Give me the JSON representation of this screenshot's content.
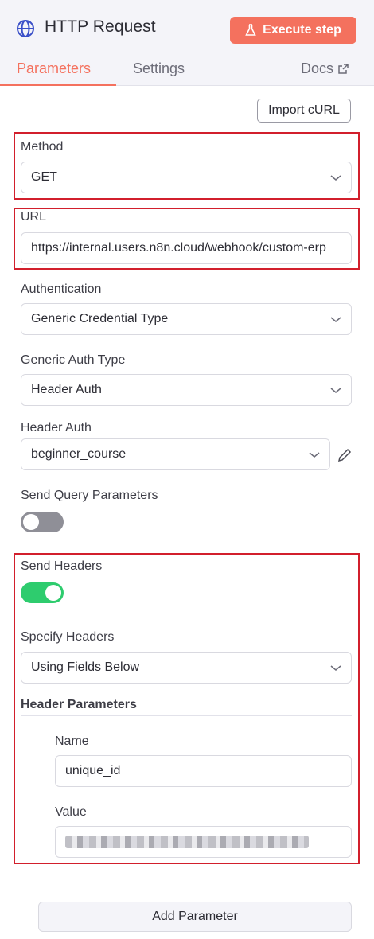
{
  "header": {
    "title": "HTTP Request",
    "execute_label": "Execute step",
    "icon": "globe-icon",
    "accent_color": "#f4715e"
  },
  "tabs": {
    "parameters": "Parameters",
    "settings": "Settings",
    "docs": "Docs",
    "active": "Parameters"
  },
  "import_curl_label": "Import cURL",
  "method": {
    "label": "Method",
    "value": "GET"
  },
  "url": {
    "label": "URL",
    "value": "https://internal.users.n8n.cloud/webhook/custom-erp"
  },
  "authentication": {
    "label": "Authentication",
    "value": "Generic Credential Type"
  },
  "generic_auth_type": {
    "label": "Generic Auth Type",
    "value": "Header Auth"
  },
  "header_auth": {
    "label": "Header Auth",
    "value": "beginner_course",
    "edit_icon": "pencil-icon"
  },
  "send_query": {
    "label": "Send Query Parameters",
    "enabled": false
  },
  "send_headers": {
    "label": "Send Headers",
    "enabled": true
  },
  "specify_headers": {
    "label": "Specify Headers",
    "value": "Using Fields Below"
  },
  "header_parameters": {
    "label": "Header Parameters",
    "name_label": "Name",
    "name_value": "unique_id",
    "value_label": "Value"
  },
  "add_parameter_label": "Add Parameter",
  "highlight_color": "#d21f2c"
}
